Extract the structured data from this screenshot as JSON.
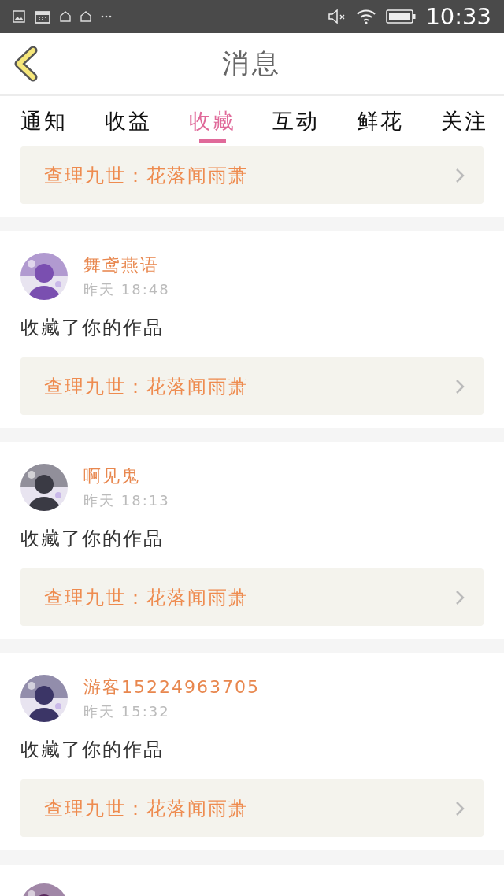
{
  "status_bar": {
    "time": "10:33"
  },
  "header": {
    "title": "消息"
  },
  "tabs": [
    {
      "label": "通知",
      "selected": false
    },
    {
      "label": "收益",
      "selected": false
    },
    {
      "label": "收藏",
      "selected": true
    },
    {
      "label": "互动",
      "selected": false
    },
    {
      "label": "鲜花",
      "selected": false
    },
    {
      "label": "关注",
      "selected": false
    }
  ],
  "partial_card": {
    "work": "查理九世：花落闻雨萧"
  },
  "messages": [
    {
      "name": "舞鸢燕语",
      "time": "昨天 18:48",
      "text": "收藏了你的作品",
      "work": "查理九世：花落闻雨萧"
    },
    {
      "name": "啊见鬼",
      "time": "昨天 18:13",
      "text": "收藏了你的作品",
      "work": "查理九世：花落闻雨萧"
    },
    {
      "name": "游客15224963705",
      "time": "昨天 15:32",
      "text": "收藏了你的作品",
      "work": "查理九世：花落闻雨萧"
    }
  ]
}
